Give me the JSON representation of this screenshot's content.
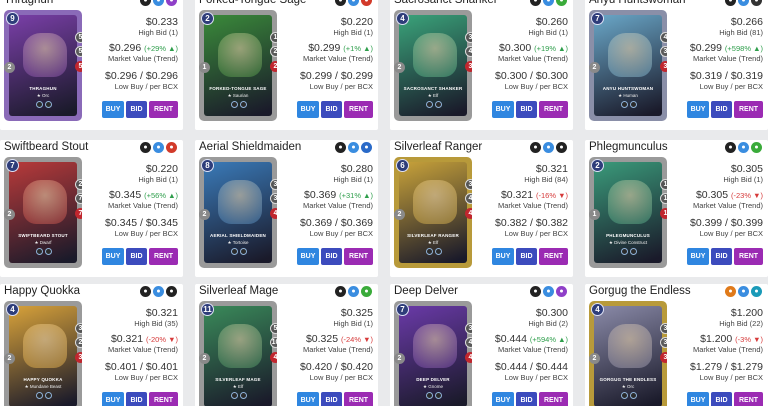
{
  "button_labels": {
    "buy": "BUY",
    "bid": "BID",
    "rent": "RENT"
  },
  "price_labels": {
    "high_bid_prefix": "High Bid",
    "market": "Market Value (Trend)",
    "low": "Low Buy / per BCX"
  },
  "cards": [
    {
      "name": "Thraghun",
      "mana": "9",
      "atk": "5",
      "spd": "5",
      "hp": "5",
      "arm": "2",
      "type_label": "Orc",
      "card_title": "THRAGHUN",
      "art_color": "#7a3fa8",
      "border_color": "#8a6ab8",
      "badges": [
        {
          "icon": "neutral-icon",
          "color": "#222"
        },
        {
          "icon": "water-icon",
          "color": "#3a8de0"
        },
        {
          "icon": "death-icon",
          "color": "#8f3fc8"
        }
      ],
      "price": "$0.233",
      "high_bid": "High Bid (1)",
      "market_value": "$0.296",
      "change": "(+29% ▲)",
      "change_dir": "pos",
      "low": "$0.296 / $0.296"
    },
    {
      "name": "Forked-Tongue Sage",
      "mana": "2",
      "atk": "1",
      "spd": "2",
      "hp": "2",
      "arm": "1",
      "type_label": "Saurian",
      "card_title": "FORKED-TONGUE SAGE",
      "art_color": "#3a8a3a",
      "border_color": "#9a9a9a",
      "badges": [
        {
          "icon": "neutral-icon",
          "color": "#222"
        },
        {
          "icon": "water-icon",
          "color": "#3a8de0"
        },
        {
          "icon": "fire-icon",
          "color": "#d23a2a"
        }
      ],
      "price": "$0.220",
      "high_bid": "High Bid (1)",
      "market_value": "$0.299",
      "change": "(+1% ▲)",
      "change_dir": "pos",
      "low": "$0.299 / $0.299"
    },
    {
      "name": "Sacrosanct Shanker",
      "mana": "4",
      "atk": "3",
      "spd": "4",
      "hp": "3",
      "arm": "2",
      "type_label": "Elf",
      "card_title": "SACROSANCT SHANKER",
      "art_color": "#3aa37a",
      "border_color": "#9a9a9a",
      "badges": [
        {
          "icon": "neutral-icon",
          "color": "#222"
        },
        {
          "icon": "water-icon",
          "color": "#3a8de0"
        },
        {
          "icon": "earth-icon",
          "color": "#3aab3a"
        }
      ],
      "price": "$0.260",
      "high_bid": "High Bid (1)",
      "market_value": "$0.300",
      "change": "(+19% ▲)",
      "change_dir": "pos",
      "low": "$0.300 / $0.300"
    },
    {
      "name": "Anyu Huntswoman",
      "mana": "7",
      "atk": "4",
      "spd": "3",
      "hp": "3",
      "arm": "2",
      "type_label": "Human",
      "card_title": "ANYU HUNTSWOMAN",
      "art_color": "#6aa7c8",
      "border_color": "#8a8fa8",
      "badges": [
        {
          "icon": "neutral-icon",
          "color": "#222"
        },
        {
          "icon": "water-icon",
          "color": "#3a8de0"
        },
        {
          "icon": "neutral-icon",
          "color": "#333"
        }
      ],
      "price": "$0.266",
      "high_bid": "High Bid (81)",
      "market_value": "$0.299",
      "change": "(+598% ▲)",
      "change_dir": "pos",
      "low": "$0.319 / $0.319"
    },
    {
      "name": "Swiftbeard Stout",
      "mana": "7",
      "atk": "2",
      "spd": "7",
      "hp": "7",
      "arm": "2",
      "type_label": "Dwarf",
      "card_title": "SWIFTBEARD STOUT",
      "art_color": "#b83a3a",
      "border_color": "#9a9a9a",
      "badges": [
        {
          "icon": "neutral-icon",
          "color": "#222"
        },
        {
          "icon": "water-icon",
          "color": "#3a8de0"
        },
        {
          "icon": "fire-icon",
          "color": "#d23a2a"
        }
      ],
      "price": "$0.220",
      "high_bid": "High Bid (1)",
      "market_value": "$0.345",
      "change": "(+56% ▲)",
      "change_dir": "pos",
      "low": "$0.345 / $0.345"
    },
    {
      "name": "Aerial Shieldmaiden",
      "mana": "8",
      "atk": "3",
      "spd": "3",
      "hp": "4",
      "arm": "2",
      "type_label": "Tortoise",
      "card_title": "AERIAL SHIELDMAIDEN",
      "art_color": "#3a7ab8",
      "border_color": "#9a9a9a",
      "badges": [
        {
          "icon": "neutral-icon",
          "color": "#222"
        },
        {
          "icon": "water-icon",
          "color": "#3a8de0"
        },
        {
          "icon": "water-icon",
          "color": "#2a6ac8"
        }
      ],
      "price": "$0.280",
      "high_bid": "High Bid (1)",
      "market_value": "$0.369",
      "change": "(+31% ▲)",
      "change_dir": "pos",
      "low": "$0.369 / $0.369"
    },
    {
      "name": "Silverleaf Ranger",
      "mana": "6",
      "atk": "3",
      "spd": "4",
      "hp": "4",
      "arm": "2",
      "type_label": "Elf",
      "card_title": "SILVERLEAF RANGER",
      "art_color": "#c8a23a",
      "border_color": "#b89a3a",
      "badges": [
        {
          "icon": "neutral-icon",
          "color": "#222"
        },
        {
          "icon": "water-icon",
          "color": "#3a8de0"
        },
        {
          "icon": "life-icon",
          "color": "#222"
        }
      ],
      "price": "$0.321",
      "high_bid": "High Bid (84)",
      "market_value": "$0.321",
      "change": "(-16% ▼)",
      "change_dir": "neg",
      "low": "$0.382 / $0.382"
    },
    {
      "name": "Phlegmunculus",
      "mana": "2",
      "atk": "1",
      "spd": "1",
      "hp": "1",
      "arm": "1",
      "type_label": "Divine Construct",
      "card_title": "PHLEGMUNCULUS",
      "art_color": "#3a9a7a",
      "border_color": "#9a9a9a",
      "badges": [
        {
          "icon": "neutral-icon",
          "color": "#222"
        },
        {
          "icon": "water-icon",
          "color": "#3a8de0"
        },
        {
          "icon": "earth-icon",
          "color": "#3aab3a"
        }
      ],
      "price": "$0.305",
      "high_bid": "High Bid (1)",
      "market_value": "$0.305",
      "change": "(-23% ▼)",
      "change_dir": "neg",
      "low": "$0.399 / $0.399"
    },
    {
      "name": "Happy Quokka",
      "mana": "4",
      "atk": "3",
      "spd": "2",
      "hp": "3",
      "arm": "2",
      "type_label": "Mundane Beast",
      "card_title": "HAPPY QUOKKA",
      "art_color": "#d8a23a",
      "border_color": "#9a9a9a",
      "badges": [
        {
          "icon": "neutral-icon",
          "color": "#222"
        },
        {
          "icon": "water-icon",
          "color": "#3a8de0"
        },
        {
          "icon": "life-icon",
          "color": "#222"
        }
      ],
      "price": "$0.321",
      "high_bid": "High Bid (35)",
      "market_value": "$0.321",
      "change": "(-20% ▼)",
      "change_dir": "neg",
      "low": "$0.401 / $0.401"
    },
    {
      "name": "Silverleaf Mage",
      "mana": "11",
      "atk": "5",
      "spd": "10",
      "hp": "4",
      "arm": "2",
      "type_label": "Elf",
      "card_title": "SILVERLEAF MAGE",
      "art_color": "#3a8a5a",
      "border_color": "#9a9a9a",
      "badges": [
        {
          "icon": "neutral-icon",
          "color": "#222"
        },
        {
          "icon": "water-icon",
          "color": "#3a8de0"
        },
        {
          "icon": "earth-icon",
          "color": "#3aab3a"
        }
      ],
      "price": "$0.325",
      "high_bid": "High Bid (1)",
      "market_value": "$0.325",
      "change": "(-24% ▼)",
      "change_dir": "neg",
      "low": "$0.420 / $0.420"
    },
    {
      "name": "Deep Delver",
      "mana": "7",
      "atk": "3",
      "spd": "4",
      "hp": "4",
      "arm": "2",
      "type_label": "Gnome",
      "card_title": "DEEP DELVER",
      "art_color": "#6a3aa8",
      "border_color": "#9a9a9a",
      "badges": [
        {
          "icon": "neutral-icon",
          "color": "#222"
        },
        {
          "icon": "water-icon",
          "color": "#3a8de0"
        },
        {
          "icon": "death-icon",
          "color": "#8f3fc8"
        }
      ],
      "price": "$0.300",
      "high_bid": "High Bid (2)",
      "market_value": "$0.444",
      "change": "(+594% ▲)",
      "change_dir": "pos",
      "low": "$0.444 / $0.444"
    },
    {
      "name": "Gorgug the Endless",
      "mana": "4",
      "atk": "3",
      "spd": "3",
      "hp": "3",
      "arm": "2",
      "type_label": "Orc",
      "card_title": "GORGUG THE ENDLESS",
      "art_color": "#8a8aa8",
      "border_color": "#b89a3a",
      "badges": [
        {
          "icon": "fire-icon",
          "color": "#e07a1a"
        },
        {
          "icon": "water-icon",
          "color": "#3a8de0"
        },
        {
          "icon": "water-icon",
          "color": "#1a9ab8"
        }
      ],
      "price": "$1.200",
      "high_bid": "High Bid (22)",
      "market_value": "$1.200",
      "change": "(-3% ▼)",
      "change_dir": "neg",
      "low": "$1.279 / $1.279"
    }
  ]
}
